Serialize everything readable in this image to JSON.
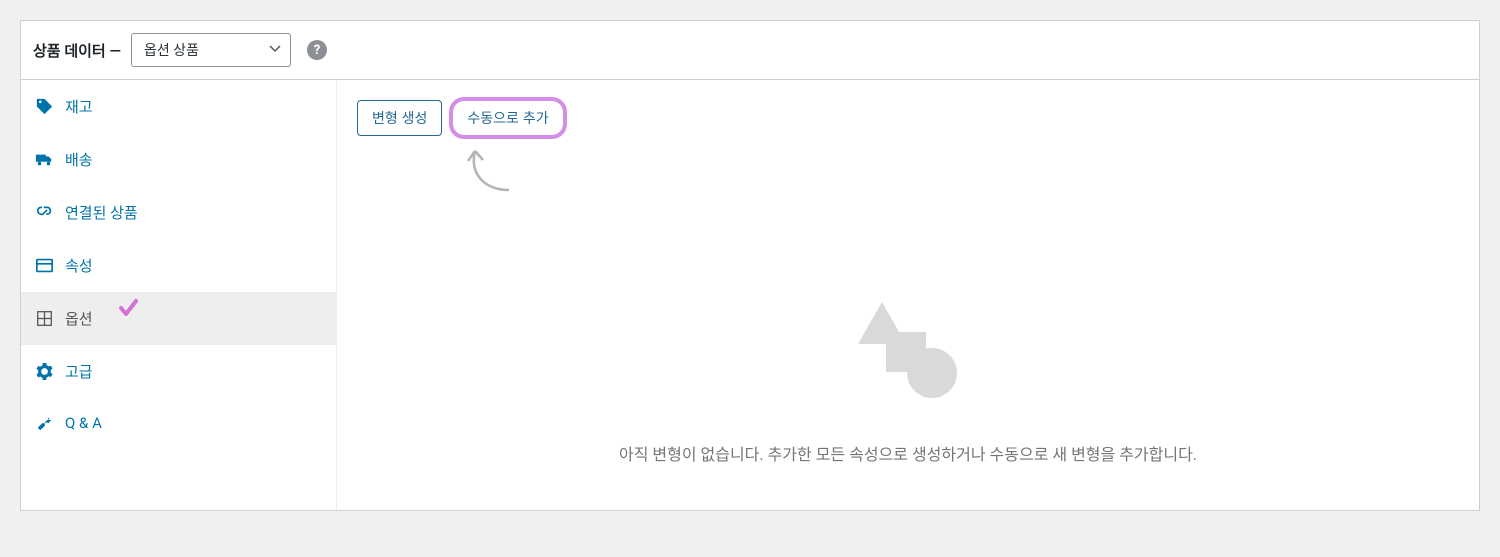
{
  "header": {
    "title": "상품 데이터 —",
    "select_value": "옵션 상품",
    "help_icon_label": "?"
  },
  "sidebar": {
    "items": [
      {
        "label": "재고",
        "icon": "tag"
      },
      {
        "label": "배송",
        "icon": "truck"
      },
      {
        "label": "연결된 상품",
        "icon": "link"
      },
      {
        "label": "속성",
        "icon": "list"
      },
      {
        "label": "옵션",
        "icon": "grid",
        "active": true
      },
      {
        "label": "고급",
        "icon": "gear"
      },
      {
        "label": "Q & A",
        "icon": "wrench"
      }
    ]
  },
  "content": {
    "create_button": "변형 생성",
    "add_manual_button": "수동으로 추가",
    "empty_text": "아직 변형이 없습니다. 추가한 모든 속성으로 생성하거나 수동으로 새 변형을 추가합니다."
  }
}
